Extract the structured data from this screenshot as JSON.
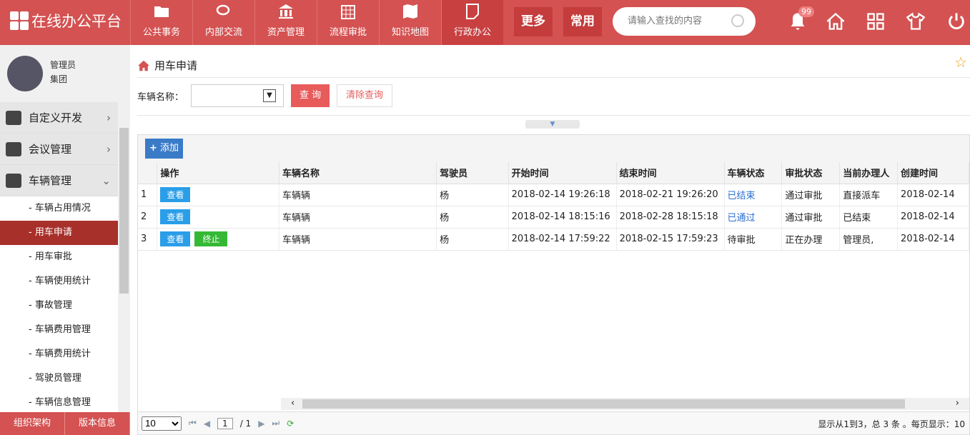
{
  "app": {
    "title": "在线办公平台",
    "nav": [
      "公共事务",
      "内部交流",
      "资产管理",
      "流程审批",
      "知识地图",
      "行政办公"
    ],
    "active_nav": "行政办公",
    "more": "更多",
    "common": "常用",
    "search_placeholder": "请输入查找的内容",
    "badge": "99"
  },
  "user": {
    "role": "管理员",
    "org": "集团"
  },
  "sidebar": {
    "groups": [
      "自定义开发",
      "会议管理",
      "车辆管理"
    ],
    "items": [
      "- 车辆占用情况",
      "- 用车申请",
      "- 用车审批",
      "- 车辆使用统计",
      "- 事故管理",
      "- 车辆费用管理",
      "- 车辆费用统计",
      "- 驾驶员管理",
      "- 车辆信息管理"
    ],
    "active": "- 用车申请",
    "footer": [
      "组织架构",
      "版本信息"
    ]
  },
  "page": {
    "title": "用车申请",
    "filter_label": "车辆名称：",
    "query": "查 询",
    "clear": "清除查询",
    "add": "添加"
  },
  "table": {
    "headers": [
      "",
      "操作",
      "车辆名称",
      "驾驶员",
      "开始时间",
      "结束时间",
      "车辆状态",
      "审批状态",
      "当前办理人",
      "创建时间"
    ],
    "rows": [
      {
        "no": "1",
        "view": "查看",
        "stop": "",
        "name": "车辆辆",
        "driver": "杨",
        "start": "2018-02-14 19:26:18",
        "end": "2018-02-21 19:26:20",
        "vstatus": "已结束",
        "astatus": "通过审批",
        "handler": "直接派车",
        "created": "2018-02-14"
      },
      {
        "no": "2",
        "view": "查看",
        "stop": "",
        "name": "车辆辆",
        "driver": "杨",
        "start": "2018-02-14 18:15:16",
        "end": "2018-02-28 18:15:18",
        "vstatus": "已通过",
        "astatus": "通过审批",
        "handler": "已结束",
        "created": "2018-02-14"
      },
      {
        "no": "3",
        "view": "查看",
        "stop": "终止",
        "name": "车辆辆",
        "driver": "杨",
        "start": "2018-02-14 17:59:22",
        "end": "2018-02-15 17:59:23",
        "vstatus": "待审批",
        "astatus": "正在办理",
        "handler": "管理员,",
        "created": "2018-02-14"
      }
    ]
  },
  "pager": {
    "page_size": "10",
    "page": "1",
    "total_pages": "/ 1",
    "info": "显示从1到3，总 3 条 。每页显示：10"
  }
}
